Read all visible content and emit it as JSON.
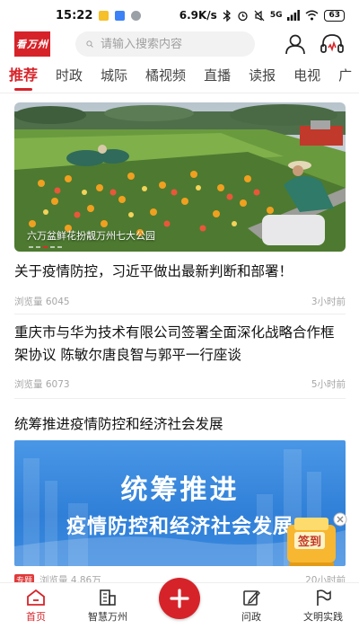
{
  "status_bar": {
    "time": "15:22",
    "speed": "6.9K/s",
    "network": "5G",
    "battery": "63"
  },
  "header": {
    "logo_text": "看万州",
    "search_placeholder": "请输入搜索内容"
  },
  "tabs": [
    {
      "label": "推荐",
      "active": true
    },
    {
      "label": "时政"
    },
    {
      "label": "城际"
    },
    {
      "label": "橘视频"
    },
    {
      "label": "直播"
    },
    {
      "label": "读报"
    },
    {
      "label": "电视"
    },
    {
      "label": "广"
    }
  ],
  "hero": {
    "caption": "六万盆鲜花扮靓万州七大公园"
  },
  "articles": [
    {
      "title": "关于疫情防控，习近平做出最新判断和部署！",
      "views": "浏览量 6045",
      "time": "3小时前"
    },
    {
      "title": "重庆市与华为技术有限公司签署全面深化战略合作框架协议 陈敏尔唐良智与郭平一行座谈",
      "views": "浏览量 6073",
      "time": "5小时前"
    },
    {
      "title": "统筹推进疫情防控和经济社会发展",
      "tag": "专题",
      "views": "浏览量 4.86万",
      "time": "20小时前"
    }
  ],
  "banner": {
    "line1": "统筹推进",
    "line2": "疫情防控和经济社会发展"
  },
  "checkin": {
    "label": "签到"
  },
  "bottom_nav": [
    {
      "label": "首页",
      "icon": "home-icon",
      "active": true
    },
    {
      "label": "智慧万州",
      "icon": "city-icon"
    },
    {
      "label": "",
      "icon": "plus-icon"
    },
    {
      "label": "问政",
      "icon": "edit-icon"
    },
    {
      "label": "文明实践",
      "icon": "flag-icon"
    }
  ],
  "colors": {
    "brand": "#d6232a",
    "banner_blue": "#2f7fd8"
  }
}
